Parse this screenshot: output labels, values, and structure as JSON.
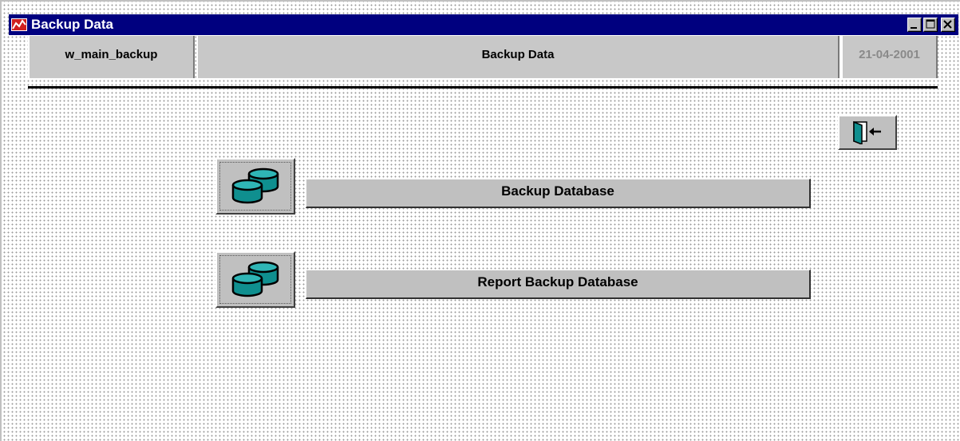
{
  "window": {
    "title": "Backup Data",
    "icon": "app-chart-icon",
    "controls": [
      "minimize-icon",
      "maximize-icon",
      "close-icon"
    ]
  },
  "header": {
    "window_name": "w_main_backup",
    "heading": "Backup Data",
    "date": "21-04-2001"
  },
  "exit_button": {
    "icon": "exit-door-icon"
  },
  "actions": [
    {
      "label": "Backup Database",
      "icon": "database-icon"
    },
    {
      "label": "Report Backup Database",
      "icon": "database-icon"
    }
  ],
  "colors": {
    "titlebar": "#00007f",
    "face": "#c0c0c0",
    "db_icon": "#0f8f8f"
  }
}
